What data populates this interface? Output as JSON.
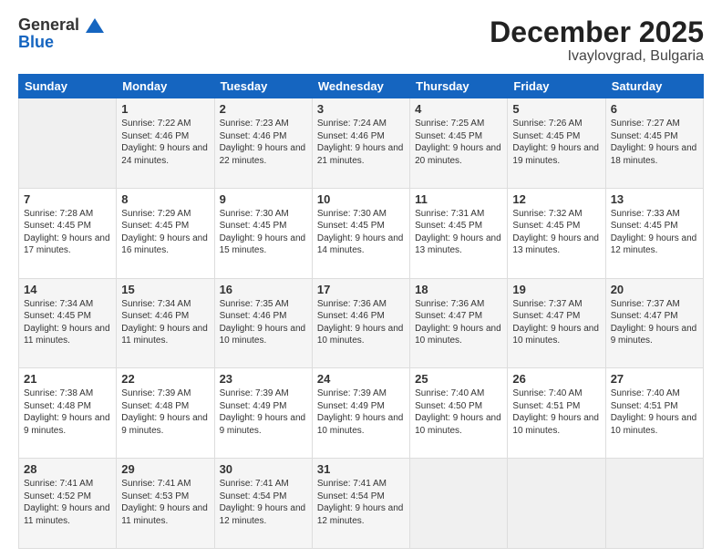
{
  "logo": {
    "general": "General",
    "blue": "Blue"
  },
  "title": "December 2025",
  "subtitle": "Ivaylovgrad, Bulgaria",
  "days_of_week": [
    "Sunday",
    "Monday",
    "Tuesday",
    "Wednesday",
    "Thursday",
    "Friday",
    "Saturday"
  ],
  "weeks": [
    [
      {
        "day": "",
        "empty": true
      },
      {
        "day": "1",
        "sunrise": "Sunrise: 7:22 AM",
        "sunset": "Sunset: 4:46 PM",
        "daylight": "Daylight: 9 hours and 24 minutes."
      },
      {
        "day": "2",
        "sunrise": "Sunrise: 7:23 AM",
        "sunset": "Sunset: 4:46 PM",
        "daylight": "Daylight: 9 hours and 22 minutes."
      },
      {
        "day": "3",
        "sunrise": "Sunrise: 7:24 AM",
        "sunset": "Sunset: 4:46 PM",
        "daylight": "Daylight: 9 hours and 21 minutes."
      },
      {
        "day": "4",
        "sunrise": "Sunrise: 7:25 AM",
        "sunset": "Sunset: 4:45 PM",
        "daylight": "Daylight: 9 hours and 20 minutes."
      },
      {
        "day": "5",
        "sunrise": "Sunrise: 7:26 AM",
        "sunset": "Sunset: 4:45 PM",
        "daylight": "Daylight: 9 hours and 19 minutes."
      },
      {
        "day": "6",
        "sunrise": "Sunrise: 7:27 AM",
        "sunset": "Sunset: 4:45 PM",
        "daylight": "Daylight: 9 hours and 18 minutes."
      }
    ],
    [
      {
        "day": "7",
        "sunrise": "Sunrise: 7:28 AM",
        "sunset": "Sunset: 4:45 PM",
        "daylight": "Daylight: 9 hours and 17 minutes."
      },
      {
        "day": "8",
        "sunrise": "Sunrise: 7:29 AM",
        "sunset": "Sunset: 4:45 PM",
        "daylight": "Daylight: 9 hours and 16 minutes."
      },
      {
        "day": "9",
        "sunrise": "Sunrise: 7:30 AM",
        "sunset": "Sunset: 4:45 PM",
        "daylight": "Daylight: 9 hours and 15 minutes."
      },
      {
        "day": "10",
        "sunrise": "Sunrise: 7:30 AM",
        "sunset": "Sunset: 4:45 PM",
        "daylight": "Daylight: 9 hours and 14 minutes."
      },
      {
        "day": "11",
        "sunrise": "Sunrise: 7:31 AM",
        "sunset": "Sunset: 4:45 PM",
        "daylight": "Daylight: 9 hours and 13 minutes."
      },
      {
        "day": "12",
        "sunrise": "Sunrise: 7:32 AM",
        "sunset": "Sunset: 4:45 PM",
        "daylight": "Daylight: 9 hours and 13 minutes."
      },
      {
        "day": "13",
        "sunrise": "Sunrise: 7:33 AM",
        "sunset": "Sunset: 4:45 PM",
        "daylight": "Daylight: 9 hours and 12 minutes."
      }
    ],
    [
      {
        "day": "14",
        "sunrise": "Sunrise: 7:34 AM",
        "sunset": "Sunset: 4:45 PM",
        "daylight": "Daylight: 9 hours and 11 minutes."
      },
      {
        "day": "15",
        "sunrise": "Sunrise: 7:34 AM",
        "sunset": "Sunset: 4:46 PM",
        "daylight": "Daylight: 9 hours and 11 minutes."
      },
      {
        "day": "16",
        "sunrise": "Sunrise: 7:35 AM",
        "sunset": "Sunset: 4:46 PM",
        "daylight": "Daylight: 9 hours and 10 minutes."
      },
      {
        "day": "17",
        "sunrise": "Sunrise: 7:36 AM",
        "sunset": "Sunset: 4:46 PM",
        "daylight": "Daylight: 9 hours and 10 minutes."
      },
      {
        "day": "18",
        "sunrise": "Sunrise: 7:36 AM",
        "sunset": "Sunset: 4:47 PM",
        "daylight": "Daylight: 9 hours and 10 minutes."
      },
      {
        "day": "19",
        "sunrise": "Sunrise: 7:37 AM",
        "sunset": "Sunset: 4:47 PM",
        "daylight": "Daylight: 9 hours and 10 minutes."
      },
      {
        "day": "20",
        "sunrise": "Sunrise: 7:37 AM",
        "sunset": "Sunset: 4:47 PM",
        "daylight": "Daylight: 9 hours and 9 minutes."
      }
    ],
    [
      {
        "day": "21",
        "sunrise": "Sunrise: 7:38 AM",
        "sunset": "Sunset: 4:48 PM",
        "daylight": "Daylight: 9 hours and 9 minutes."
      },
      {
        "day": "22",
        "sunrise": "Sunrise: 7:39 AM",
        "sunset": "Sunset: 4:48 PM",
        "daylight": "Daylight: 9 hours and 9 minutes."
      },
      {
        "day": "23",
        "sunrise": "Sunrise: 7:39 AM",
        "sunset": "Sunset: 4:49 PM",
        "daylight": "Daylight: 9 hours and 9 minutes."
      },
      {
        "day": "24",
        "sunrise": "Sunrise: 7:39 AM",
        "sunset": "Sunset: 4:49 PM",
        "daylight": "Daylight: 9 hours and 10 minutes."
      },
      {
        "day": "25",
        "sunrise": "Sunrise: 7:40 AM",
        "sunset": "Sunset: 4:50 PM",
        "daylight": "Daylight: 9 hours and 10 minutes."
      },
      {
        "day": "26",
        "sunrise": "Sunrise: 7:40 AM",
        "sunset": "Sunset: 4:51 PM",
        "daylight": "Daylight: 9 hours and 10 minutes."
      },
      {
        "day": "27",
        "sunrise": "Sunrise: 7:40 AM",
        "sunset": "Sunset: 4:51 PM",
        "daylight": "Daylight: 9 hours and 10 minutes."
      }
    ],
    [
      {
        "day": "28",
        "sunrise": "Sunrise: 7:41 AM",
        "sunset": "Sunset: 4:52 PM",
        "daylight": "Daylight: 9 hours and 11 minutes."
      },
      {
        "day": "29",
        "sunrise": "Sunrise: 7:41 AM",
        "sunset": "Sunset: 4:53 PM",
        "daylight": "Daylight: 9 hours and 11 minutes."
      },
      {
        "day": "30",
        "sunrise": "Sunrise: 7:41 AM",
        "sunset": "Sunset: 4:54 PM",
        "daylight": "Daylight: 9 hours and 12 minutes."
      },
      {
        "day": "31",
        "sunrise": "Sunrise: 7:41 AM",
        "sunset": "Sunset: 4:54 PM",
        "daylight": "Daylight: 9 hours and 12 minutes."
      },
      {
        "day": "",
        "empty": true
      },
      {
        "day": "",
        "empty": true
      },
      {
        "day": "",
        "empty": true
      }
    ]
  ]
}
